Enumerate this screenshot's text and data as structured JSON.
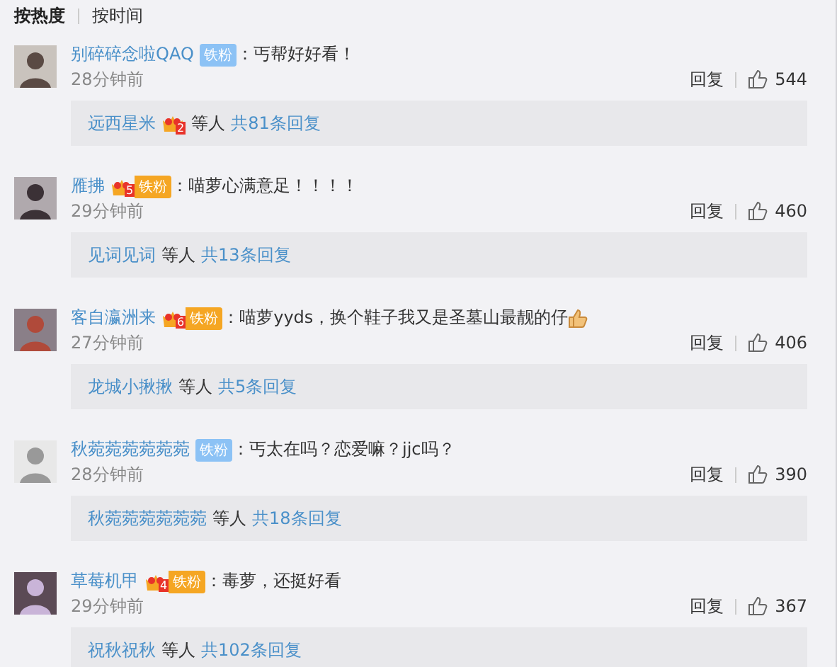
{
  "sort_tabs": [
    {
      "label": "按热度",
      "selected": true
    },
    {
      "label": "按时间",
      "selected": false
    }
  ],
  "comments": [
    {
      "user": "别碎碎念啦QAQ",
      "badge": {
        "kind": "plain",
        "label": "铁粉"
      },
      "text": "：丐帮好好看！",
      "time": "28分钟前",
      "reply_label": "回复",
      "likes": "544",
      "replies": {
        "user": "远西星米",
        "badge_level": "2",
        "suffix": "等人",
        "count": "共81条回复"
      }
    },
    {
      "user": "雁拂",
      "badge": {
        "kind": "crown",
        "label": "铁粉",
        "level": "5"
      },
      "text": "：喵萝心满意足！！！！",
      "time": "29分钟前",
      "reply_label": "回复",
      "likes": "460",
      "replies": {
        "user": "见词见词",
        "suffix": "等人",
        "count": "共13条回复"
      }
    },
    {
      "user": "客自瀛洲来",
      "badge": {
        "kind": "crown",
        "label": "铁粉",
        "level": "6"
      },
      "text": "：喵萝yyds，换个鞋子我又是圣墓山最靓的仔",
      "emojis": [
        {
          "kind": "thumbs-up"
        }
      ],
      "time": "27分钟前",
      "reply_label": "回复",
      "likes": "406",
      "replies": {
        "user": "龙城小揪揪",
        "suffix": "等人",
        "count": "共5条回复"
      }
    },
    {
      "user": "秋菀菀菀菀菀菀",
      "badge": {
        "kind": "plain",
        "label": "铁粉"
      },
      "text": "：丐太在吗？恋爱嘛？jjc吗？",
      "time": "28分钟前",
      "reply_label": "回复",
      "likes": "390",
      "replies": {
        "user": "秋菀菀菀菀菀菀",
        "suffix": "等人",
        "count": "共18条回复"
      }
    },
    {
      "user": "草莓机甲",
      "badge": {
        "kind": "crown",
        "label": "铁粉",
        "level": "4"
      },
      "text": "：毒萝，还挺好看",
      "time": "29分钟前",
      "reply_label": "回复",
      "likes": "367",
      "replies": {
        "user": "祝秋祝秋",
        "suffix": "等人",
        "count": "共102条回复"
      }
    }
  ]
}
